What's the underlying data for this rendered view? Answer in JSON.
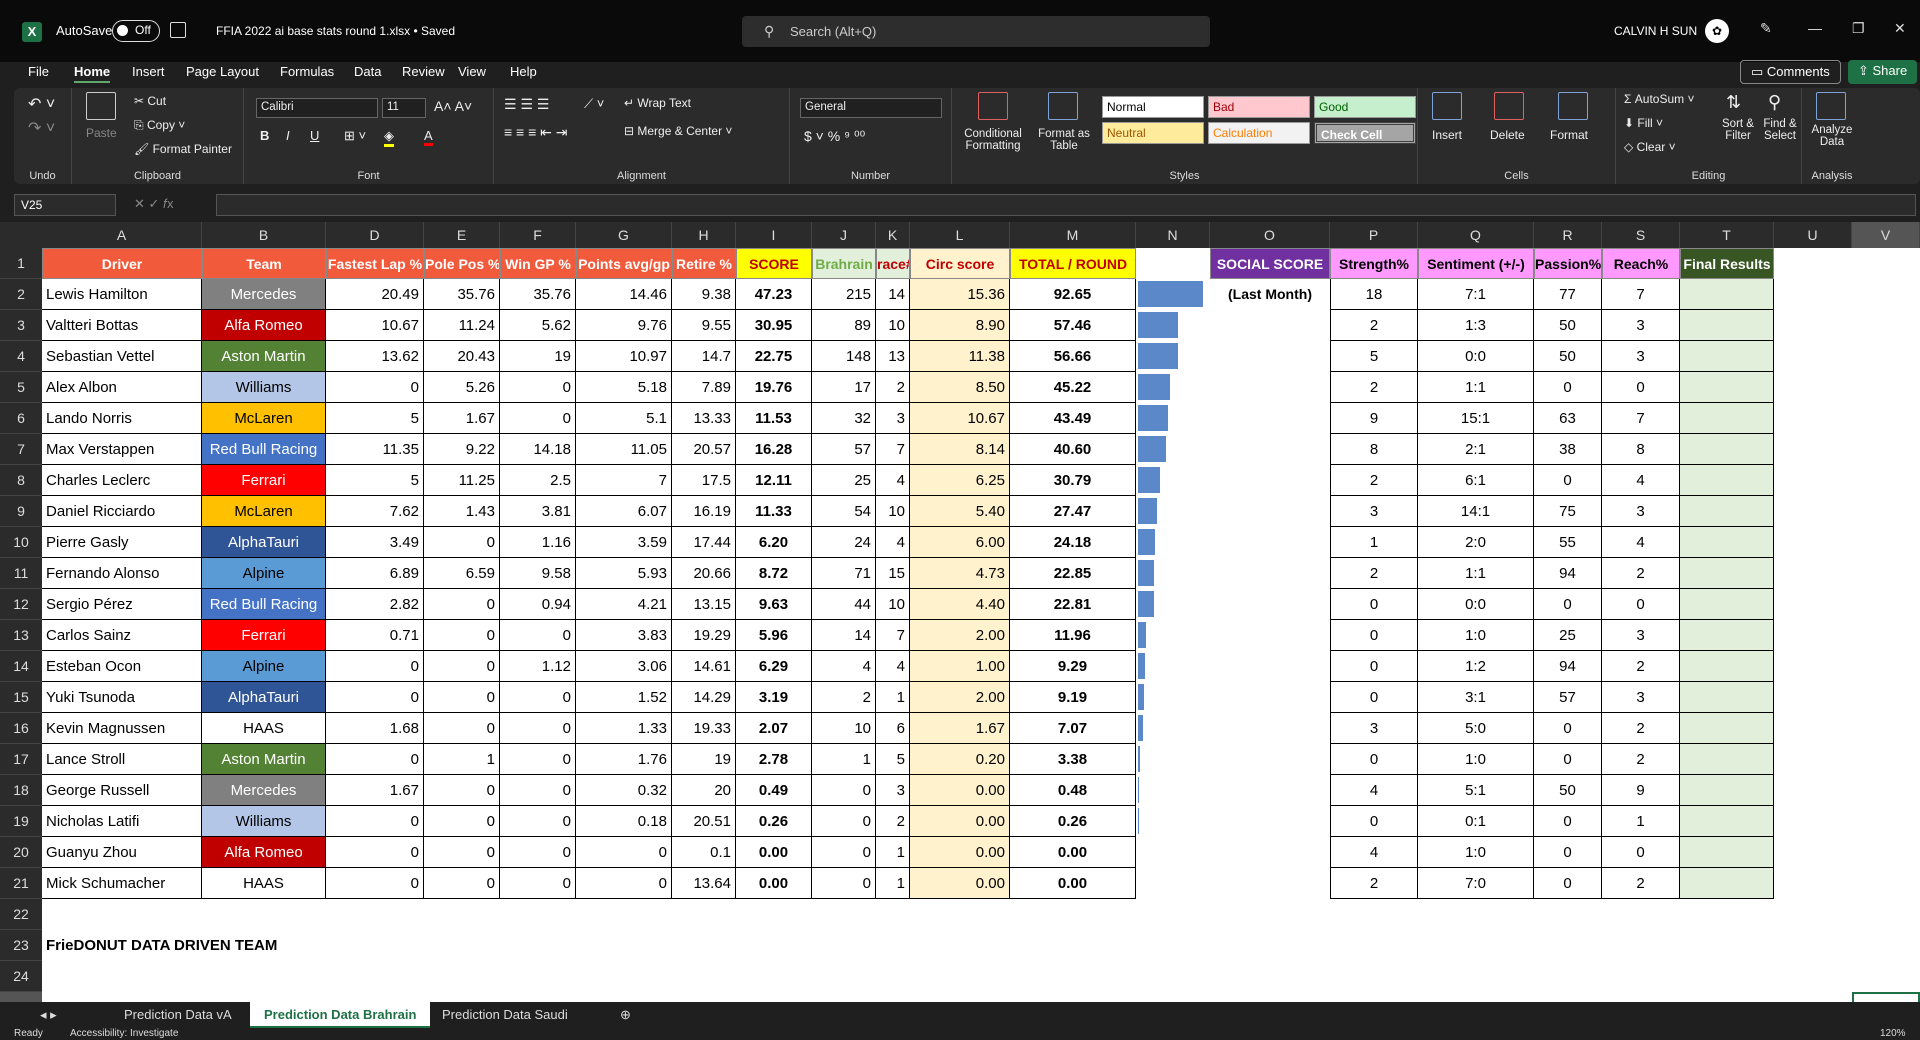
{
  "titlebar": {
    "app_icon": "X",
    "autosave_label": "AutoSave",
    "autosave_state": "Off",
    "file_name": "FFIA 2022 ai base stats round 1.xlsx • Saved",
    "search_placeholder": "Search (Alt+Q)",
    "user_name": "CALVIN H SUN"
  },
  "menu": {
    "items": [
      "File",
      "Home",
      "Insert",
      "Page Layout",
      "Formulas",
      "Data",
      "Review",
      "View",
      "Help"
    ],
    "active": "Home",
    "comments_label": "Comments",
    "share_label": "Share"
  },
  "ribbon": {
    "undo": {
      "label": "Undo"
    },
    "clipboard": {
      "paste": "Paste",
      "cut": "Cut",
      "copy": "Copy",
      "format_painter": "Format Painter",
      "label": "Clipboard"
    },
    "font": {
      "name": "Calibri",
      "size": "11",
      "label": "Font",
      "bold": "B",
      "italic": "I",
      "underline": "U"
    },
    "alignment": {
      "wrap_text": "Wrap Text",
      "merge_center": "Merge & Center",
      "label": "Alignment"
    },
    "number": {
      "format": "General",
      "label": "Number"
    },
    "styles": {
      "conditional": "Conditional Formatting",
      "format_table": "Format as Table",
      "normal": "Normal",
      "bad": "Bad",
      "good": "Good",
      "neutral": "Neutral",
      "calculation": "Calculation",
      "check_cell": "Check Cell",
      "label": "Styles"
    },
    "cells": {
      "insert": "Insert",
      "delete": "Delete",
      "format": "Format",
      "label": "Cells"
    },
    "editing": {
      "autosum": "AutoSum",
      "fill": "Fill",
      "clear": "Clear",
      "sort_filter": "Sort & Filter",
      "find_select": "Find & Select",
      "label": "Editing"
    },
    "analysis": {
      "analyze": "Analyze Data",
      "label": "Analysis"
    }
  },
  "formula_bar": {
    "name_box": "V25",
    "formula": ""
  },
  "columns": [
    "A",
    "B",
    "D",
    "E",
    "F",
    "G",
    "H",
    "I",
    "J",
    "K",
    "L",
    "M",
    "N",
    "O",
    "P",
    "Q",
    "R",
    "S",
    "T",
    "U",
    "V"
  ],
  "headers": {
    "driver": "Driver",
    "team": "Team",
    "fastest": "Fastest Lap %",
    "pole": "Pole Pos %",
    "wingp": "Win GP %",
    "points": "Points avg/gp",
    "retire": "Retire %",
    "score": "SCORE",
    "bahrain": "Brahrain",
    "race": "race#",
    "circ": "Circ score",
    "total": "TOTAL / ROUND",
    "social": "SOCIAL SCORE",
    "social_sub": "(Last Month)",
    "strength": "Strength%",
    "sentiment": "Sentiment (+/-)",
    "passion": "Passion%",
    "reach": "Reach%",
    "final": "Final Results"
  },
  "colors": {
    "driver_header": "#f25a3c",
    "score_header": "#ffff00",
    "bahrain_header": "#70ad47",
    "race_header": "#e2efda",
    "circ_header": "#fff2cc",
    "total_header": "#ffff00",
    "social_header": "#7030a0",
    "pink_header": "#ff99ff",
    "final_header": "#375623",
    "final_fill": "#e2efda",
    "circ_fill": "#fff2cc",
    "bar": "#5b88c8"
  },
  "rows": [
    {
      "driver": "Lewis Hamilton",
      "team": "Mercedes",
      "fl": "20.49",
      "pp": "35.76",
      "wg": "35.76",
      "pa": "14.46",
      "rt": "9.38",
      "score": "47.23",
      "bh": "215",
      "race": "14",
      "circ": "15.36",
      "total": "92.65",
      "st": "18",
      "se": "7:1",
      "pa2": "77",
      "re": "7"
    },
    {
      "driver": "Valtteri Bottas",
      "team": "Alfa Romeo",
      "fl": "10.67",
      "pp": "11.24",
      "wg": "5.62",
      "pa": "9.76",
      "rt": "9.55",
      "score": "30.95",
      "bh": "89",
      "race": "10",
      "circ": "8.90",
      "total": "57.46",
      "st": "2",
      "se": "1:3",
      "pa2": "50",
      "re": "3"
    },
    {
      "driver": "Sebastian Vettel",
      "team": "Aston Martin",
      "fl": "13.62",
      "pp": "20.43",
      "wg": "19",
      "pa": "10.97",
      "rt": "14.7",
      "score": "22.75",
      "bh": "148",
      "race": "13",
      "circ": "11.38",
      "total": "56.66",
      "st": "5",
      "se": "0:0",
      "pa2": "50",
      "re": "3"
    },
    {
      "driver": "Alex Albon",
      "team": "Williams",
      "fl": "0",
      "pp": "5.26",
      "wg": "0",
      "pa": "5.18",
      "rt": "7.89",
      "score": "19.76",
      "bh": "17",
      "race": "2",
      "circ": "8.50",
      "total": "45.22",
      "st": "2",
      "se": "1:1",
      "pa2": "0",
      "re": "0"
    },
    {
      "driver": "Lando Norris",
      "team": "McLaren",
      "fl": "5",
      "pp": "1.67",
      "wg": "0",
      "pa": "5.1",
      "rt": "13.33",
      "score": "11.53",
      "bh": "32",
      "race": "3",
      "circ": "10.67",
      "total": "43.49",
      "st": "9",
      "se": "15:1",
      "pa2": "63",
      "re": "7"
    },
    {
      "driver": "Max Verstappen",
      "team": "Red Bull Racing",
      "fl": "11.35",
      "pp": "9.22",
      "wg": "14.18",
      "pa": "11.05",
      "rt": "20.57",
      "score": "16.28",
      "bh": "57",
      "race": "7",
      "circ": "8.14",
      "total": "40.60",
      "st": "8",
      "se": "2:1",
      "pa2": "38",
      "re": "8"
    },
    {
      "driver": "Charles Leclerc",
      "team": "Ferrari",
      "fl": "5",
      "pp": "11.25",
      "wg": "2.5",
      "pa": "7",
      "rt": "17.5",
      "score": "12.11",
      "bh": "25",
      "race": "4",
      "circ": "6.25",
      "total": "30.79",
      "st": "2",
      "se": "6:1",
      "pa2": "0",
      "re": "4"
    },
    {
      "driver": "Daniel Ricciardo",
      "team": "McLaren",
      "fl": "7.62",
      "pp": "1.43",
      "wg": "3.81",
      "pa": "6.07",
      "rt": "16.19",
      "score": "11.33",
      "bh": "54",
      "race": "10",
      "circ": "5.40",
      "total": "27.47",
      "st": "3",
      "se": "14:1",
      "pa2": "75",
      "re": "3"
    },
    {
      "driver": "Pierre Gasly",
      "team": "AlphaTauri",
      "fl": "3.49",
      "pp": "0",
      "wg": "1.16",
      "pa": "3.59",
      "rt": "17.44",
      "score": "6.20",
      "bh": "24",
      "race": "4",
      "circ": "6.00",
      "total": "24.18",
      "st": "1",
      "se": "2:0",
      "pa2": "55",
      "re": "4"
    },
    {
      "driver": "Fernando Alonso",
      "team": "Alpine",
      "fl": "6.89",
      "pp": "6.59",
      "wg": "9.58",
      "pa": "5.93",
      "rt": "20.66",
      "score": "8.72",
      "bh": "71",
      "race": "15",
      "circ": "4.73",
      "total": "22.85",
      "st": "2",
      "se": "1:1",
      "pa2": "94",
      "re": "2"
    },
    {
      "driver": "Sergio Pérez",
      "team": "Red Bull Racing",
      "fl": "2.82",
      "pp": "0",
      "wg": "0.94",
      "pa": "4.21",
      "rt": "13.15",
      "score": "9.63",
      "bh": "44",
      "race": "10",
      "circ": "4.40",
      "total": "22.81",
      "st": "0",
      "se": "0:0",
      "pa2": "0",
      "re": "0"
    },
    {
      "driver": "Carlos Sainz",
      "team": "Ferrari",
      "fl": "0.71",
      "pp": "0",
      "wg": "0",
      "pa": "3.83",
      "rt": "19.29",
      "score": "5.96",
      "bh": "14",
      "race": "7",
      "circ": "2.00",
      "total": "11.96",
      "st": "0",
      "se": "1:0",
      "pa2": "25",
      "re": "3"
    },
    {
      "driver": "Esteban Ocon",
      "team": "Alpine",
      "fl": "0",
      "pp": "0",
      "wg": "1.12",
      "pa": "3.06",
      "rt": "14.61",
      "score": "6.29",
      "bh": "4",
      "race": "4",
      "circ": "1.00",
      "total": "9.29",
      "st": "0",
      "se": "1:2",
      "pa2": "94",
      "re": "2"
    },
    {
      "driver": "Yuki Tsunoda",
      "team": "AlphaTauri",
      "fl": "0",
      "pp": "0",
      "wg": "0",
      "pa": "1.52",
      "rt": "14.29",
      "score": "3.19",
      "bh": "2",
      "race": "1",
      "circ": "2.00",
      "total": "9.19",
      "st": "0",
      "se": "3:1",
      "pa2": "57",
      "re": "3"
    },
    {
      "driver": "Kevin Magnussen",
      "team": "HAAS",
      "fl": "1.68",
      "pp": "0",
      "wg": "0",
      "pa": "1.33",
      "rt": "19.33",
      "score": "2.07",
      "bh": "10",
      "race": "6",
      "circ": "1.67",
      "total": "7.07",
      "st": "3",
      "se": "5:0",
      "pa2": "0",
      "re": "2"
    },
    {
      "driver": "Lance Stroll",
      "team": "Aston Martin",
      "fl": "0",
      "pp": "1",
      "wg": "0",
      "pa": "1.76",
      "rt": "19",
      "score": "2.78",
      "bh": "1",
      "race": "5",
      "circ": "0.20",
      "total": "3.38",
      "st": "0",
      "se": "1:0",
      "pa2": "0",
      "re": "2"
    },
    {
      "driver": "George Russell",
      "team": "Mercedes",
      "fl": "1.67",
      "pp": "0",
      "wg": "0",
      "pa": "0.32",
      "rt": "20",
      "score": "0.49",
      "bh": "0",
      "race": "3",
      "circ": "0.00",
      "total": "0.48",
      "st": "4",
      "se": "5:1",
      "pa2": "50",
      "re": "9"
    },
    {
      "driver": "Nicholas Latifi",
      "team": "Williams",
      "fl": "0",
      "pp": "0",
      "wg": "0",
      "pa": "0.18",
      "rt": "20.51",
      "score": "0.26",
      "bh": "0",
      "race": "2",
      "circ": "0.00",
      "total": "0.26",
      "st": "0",
      "se": "0:1",
      "pa2": "0",
      "re": "1"
    },
    {
      "driver": "Guanyu Zhou",
      "team": "Alfa Romeo",
      "fl": "0",
      "pp": "0",
      "wg": "0",
      "pa": "0",
      "rt": "0.1",
      "score": "0.00",
      "bh": "0",
      "race": "1",
      "circ": "0.00",
      "total": "0.00",
      "st": "4",
      "se": "1:0",
      "pa2": "0",
      "re": "0"
    },
    {
      "driver": "Mick Schumacher",
      "team": "HAAS",
      "fl": "0",
      "pp": "0",
      "wg": "0",
      "pa": "0",
      "rt": "13.64",
      "score": "0.00",
      "bh": "0",
      "race": "1",
      "circ": "0.00",
      "total": "0.00",
      "st": "2",
      "se": "7:0",
      "pa2": "0",
      "re": "2"
    }
  ],
  "team_colors": {
    "Mercedes": [
      "#808080",
      "#fff"
    ],
    "Alfa Romeo": [
      "#c00000",
      "#fff"
    ],
    "Aston Martin": [
      "#548235",
      "#fff"
    ],
    "Williams": [
      "#b4c6e7",
      "#000"
    ],
    "McLaren": [
      "#ffc000",
      "#000"
    ],
    "Red Bull Racing": [
      "#4472c4",
      "#fff"
    ],
    "Ferrari": [
      "#ff0000",
      "#fff"
    ],
    "AlphaTauri": [
      "#2f5597",
      "#fff"
    ],
    "Alpine": [
      "#5b9bd5",
      "#000"
    ],
    "HAAS": [
      "#ffffff",
      "#000"
    ]
  },
  "footer_text": "FrieDONUT DATA DRIVEN TEAM",
  "sheets": [
    "Prediction Data vA",
    "Prediction Data Brahrain",
    "Prediction Data Saudi"
  ],
  "active_sheet": "Prediction Data Brahrain",
  "status": {
    "ready": "Ready",
    "accessibility": "Accessibility: Investigate",
    "zoom": "120%"
  }
}
